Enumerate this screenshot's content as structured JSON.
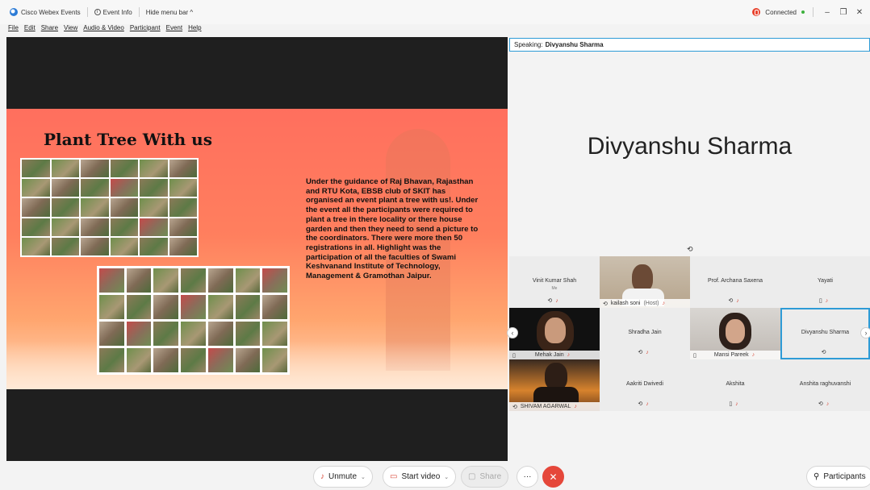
{
  "titlebar": {
    "app_name": "Cisco Webex Events",
    "event_info": "Event Info",
    "hide_menu": "Hide menu bar ^",
    "connection": "Connected",
    "minimize": "–",
    "restore": "❐",
    "close": "✕"
  },
  "menu": [
    "File",
    "Edit",
    "Share",
    "View",
    "Audio & Video",
    "Participant",
    "Event",
    "Help"
  ],
  "slide": {
    "title": "Plant Tree With us",
    "body": "Under the guidance of Raj Bhavan, Rajasthan and RTU Kota, EBSB club of SKIT has organised an event plant a tree with us!. Under the event all the participants were required to plant a tree in there locality or there house garden and then they need to send a picture to the coordinators. There were more then 50 registrations in all. Highlight was the participation of all the faculties of Swami Keshvanand Institute of Technology, Management & Gramothan Jaipur."
  },
  "speaking": {
    "label": "Speaking:",
    "name": "Divyanshu Sharma"
  },
  "active_speaker": "Divyanshu Sharma",
  "participants": [
    {
      "name": "Vinit Kumar Shah",
      "sub": "Me"
    },
    {
      "name": "kailash soni",
      "role": "(Host)"
    },
    {
      "name": "Prof. Archana Saxena"
    },
    {
      "name": "Yayati"
    },
    {
      "name": "Mehak Jain"
    },
    {
      "name": "Shradha Jain"
    },
    {
      "name": "Mansi Pareek"
    },
    {
      "name": "Divyanshu Sharma"
    },
    {
      "name": "SHIVAM AGARWAL"
    },
    {
      "name": "Aakriti Dwivedi"
    },
    {
      "name": "Akshita"
    },
    {
      "name": "Anshita raghuvanshi"
    }
  ],
  "controls": {
    "unmute": "Unmute",
    "start_video": "Start video",
    "share": "Share",
    "more": "···",
    "participants": "Participants"
  },
  "colors": {
    "accent": "#2e9bd6",
    "end_call": "#e5473a",
    "muted": "#d94a3a"
  }
}
